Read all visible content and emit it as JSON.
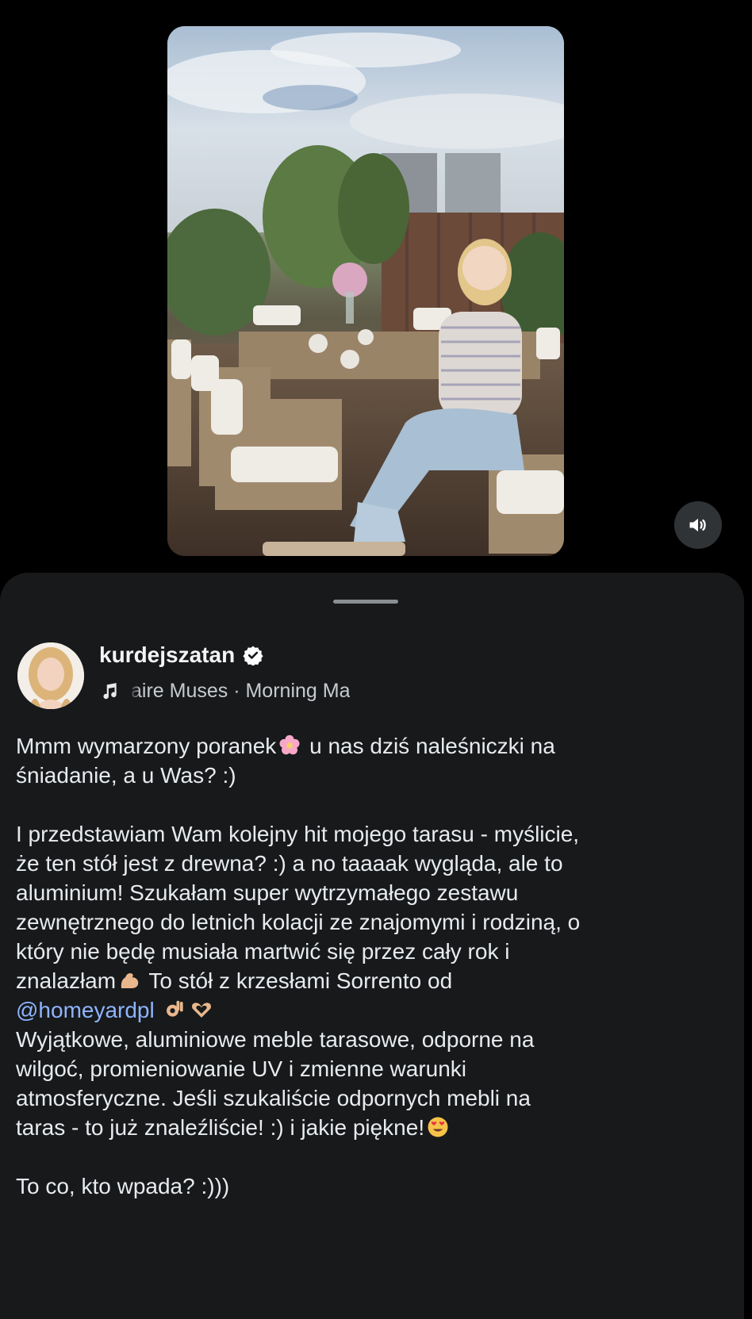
{
  "post": {
    "username": "kurdejszatan",
    "music": "aire Muses · Morning Ma",
    "caption": {
      "p1_a": "Mmm wymarzony poranek",
      "p1_b": " u nas dziś naleśniczki na",
      "p1_c": "śniadanie, a u Was? :)",
      "p2_l1": "I przedstawiam Wam kolejny hit mojego tarasu - myślicie,",
      "p2_l2": "że ten stół jest z drewna? :) a no taaaak wygląda, ale to",
      "p2_l3": "aluminium! Szukałam super wytrzymałego zestawu",
      "p2_l4": "zewnętrznego do letnich kolacji ze znajomymi i rodziną, o",
      "p2_l5": "który nie będę musiała martwić się przez cały rok i",
      "p2_l6a": "znalazłam",
      "p2_l6b": " To stół z krzesłami Sorrento od",
      "mention": "@homeyardpl",
      "p3_l1": "Wyjątkowe, aluminiowe meble tarasowe, odporne na",
      "p3_l2": "wilgoć, promieniowanie UV i zmienne warunki",
      "p3_l3": "atmosferyczne. Jeśli szukaliście odpornych mebli na",
      "p3_l4": "taras - to już znaleźliście! :) i jakie piękne!",
      "p4": "To co, kto wpada? :)))"
    }
  },
  "icons": {
    "sound": "speaker-icon",
    "verified": "verified-badge-icon",
    "music": "music-note-icon",
    "emojis": [
      "cherry-blossom-emoji",
      "flexed-biceps-emoji",
      "ok-hand-emoji",
      "heart-hands-emoji",
      "heart-eyes-emoji"
    ]
  },
  "colors": {
    "background": "#000000",
    "sheet": "#17191b",
    "mention": "#8fb4ff",
    "text": "#e8ebee"
  }
}
